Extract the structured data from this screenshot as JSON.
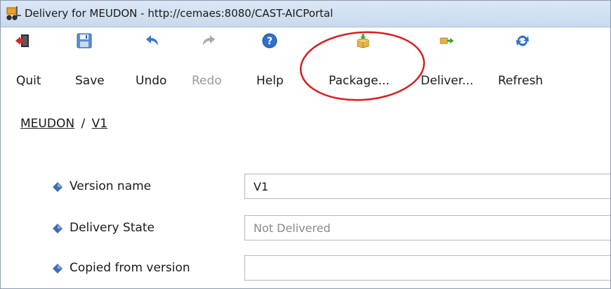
{
  "window": {
    "title": "Delivery for MEUDON - http://cemaes:8080/CAST-AICPortal",
    "app_icon": "forklift-icon"
  },
  "toolbar": {
    "items": [
      {
        "id": "quit",
        "label": "Quit",
        "icon": "quit-door-icon",
        "enabled": true
      },
      {
        "id": "save",
        "label": "Save",
        "icon": "floppy-disk-icon",
        "enabled": true
      },
      {
        "id": "undo",
        "label": "Undo",
        "icon": "undo-arrow-icon",
        "enabled": true
      },
      {
        "id": "redo",
        "label": "Redo",
        "icon": "redo-arrow-icon",
        "enabled": false
      },
      {
        "id": "help",
        "label": "Help",
        "icon": "question-mark-icon",
        "enabled": true
      },
      {
        "id": "package",
        "label": "Package...",
        "icon": "package-box-icon",
        "enabled": true
      },
      {
        "id": "deliver",
        "label": "Deliver...",
        "icon": "deliver-truck-icon",
        "enabled": true
      },
      {
        "id": "refresh",
        "label": "Refresh",
        "icon": "refresh-icon",
        "enabled": true
      }
    ],
    "annotation": {
      "shape": "ellipse",
      "color": "#d42020",
      "encircles": "package"
    }
  },
  "breadcrumb": {
    "root": "MEUDON",
    "separator": "/",
    "current": "V1"
  },
  "form": {
    "version_name": {
      "label": "Version name",
      "value": "V1"
    },
    "delivery_state": {
      "label": "Delivery State",
      "value": "Not Delivered"
    },
    "copied_from": {
      "label": "Copied from version",
      "value": ""
    }
  },
  "colors": {
    "titlebar": "#c9daee",
    "bullet": "#3f6db0",
    "annotation": "#d42020"
  }
}
